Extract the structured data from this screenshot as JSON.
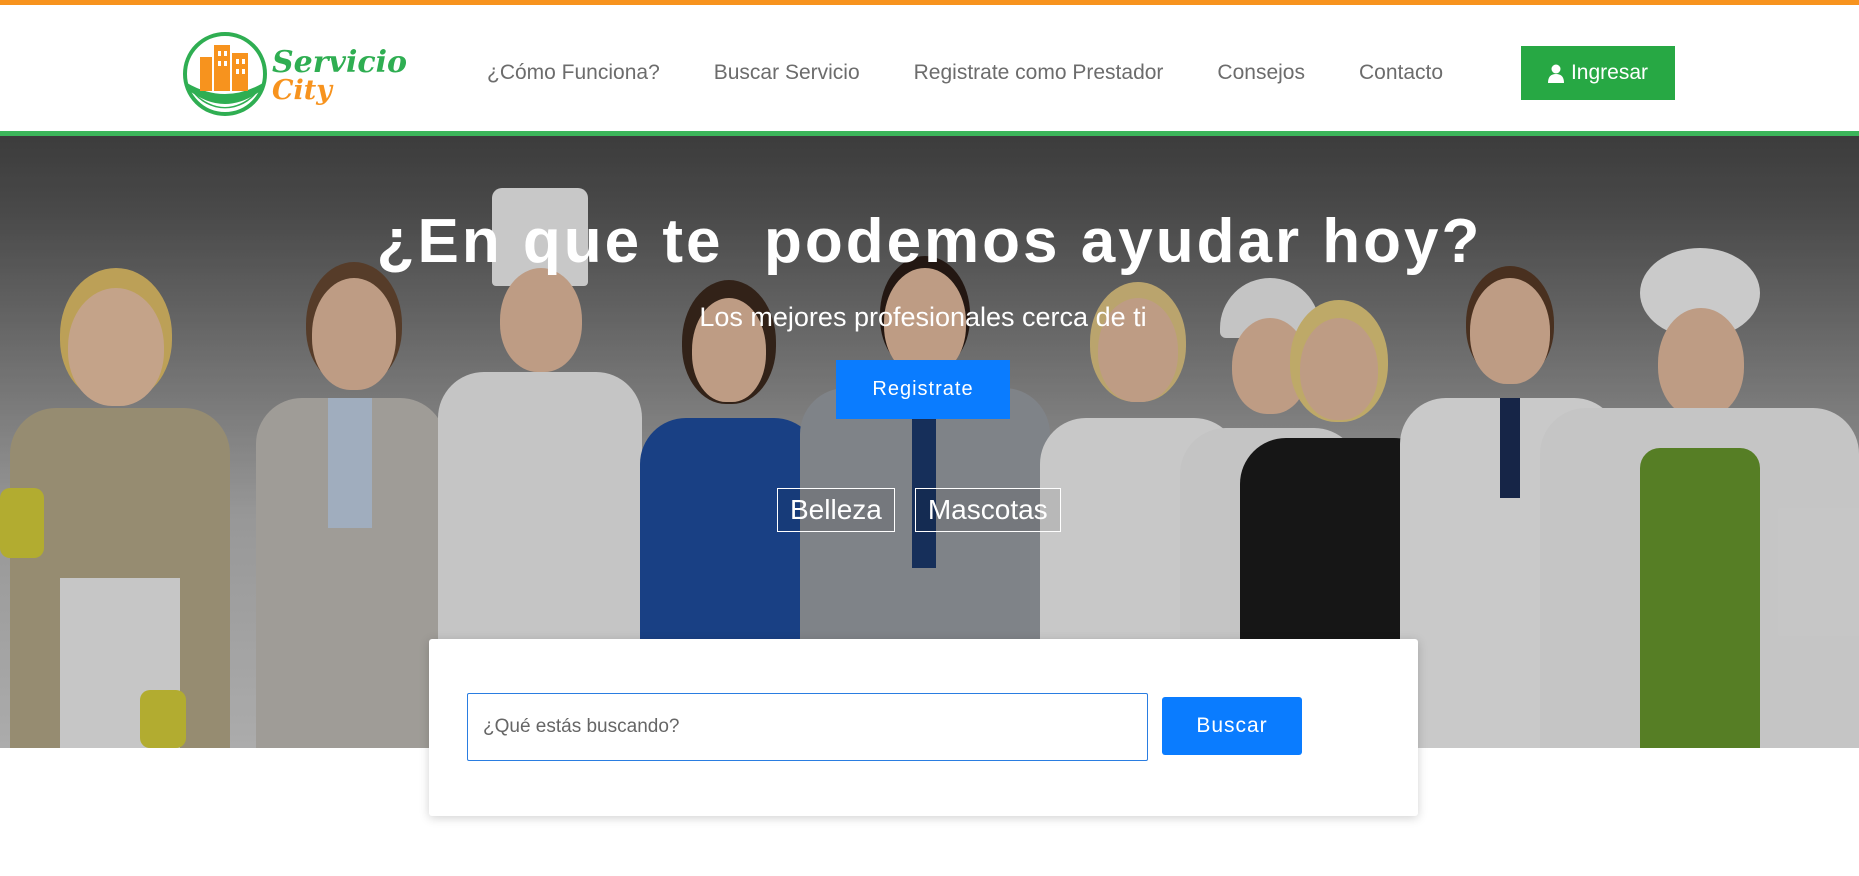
{
  "brand": {
    "name_line1": "Servicio",
    "name_line2": "City"
  },
  "nav": {
    "items": [
      {
        "label": "¿Cómo Funciona?"
      },
      {
        "label": "Buscar Servicio"
      },
      {
        "label": "Registrate como Prestador"
      },
      {
        "label": "Consejos"
      },
      {
        "label": "Contacto"
      }
    ],
    "login_label": "Ingresar",
    "login_icon": "user-icon"
  },
  "hero": {
    "title": "¿En que te  podemos ayudar hoy?",
    "subtitle": "Los mejores profesionales cerca de ti",
    "cta_label": "Registrate",
    "tags": [
      {
        "label": "Belleza"
      },
      {
        "label": "Mascotas"
      }
    ]
  },
  "search": {
    "placeholder": "¿Qué estás buscando?",
    "button_label": "Buscar"
  },
  "colors": {
    "accent_orange": "#f7931e",
    "brand_green": "#2fae52",
    "primary_blue": "#0a7cff",
    "login_green": "#27a844"
  }
}
